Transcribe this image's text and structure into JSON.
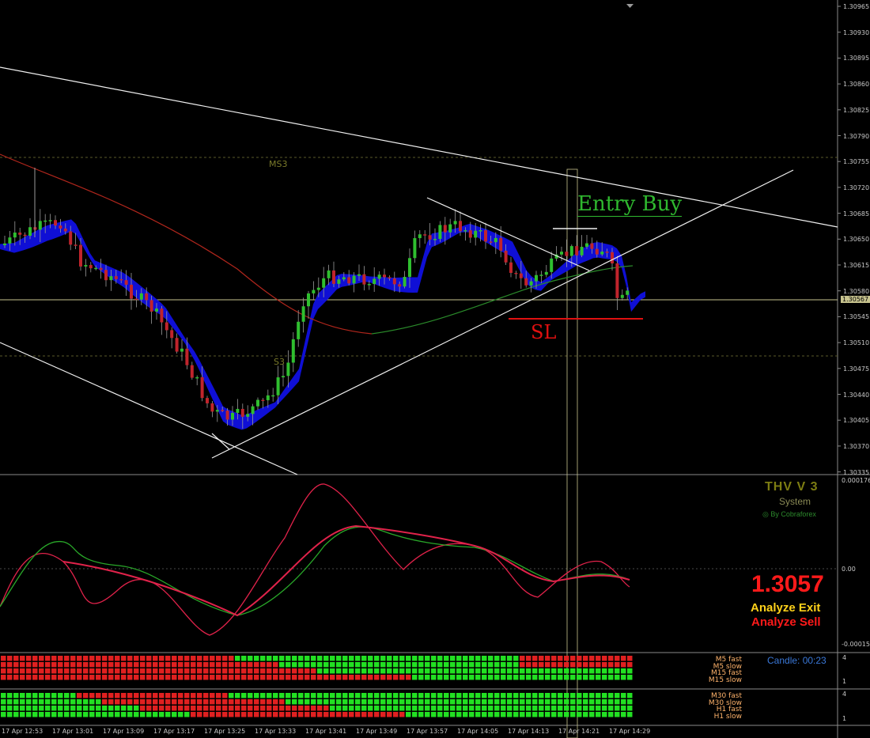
{
  "chart": {
    "symbol_levels": [
      "1.30965",
      "1.30930",
      "1.30895",
      "1.30860",
      "1.30825",
      "1.30790",
      "1.30755",
      "1.30720",
      "1.30685",
      "1.30650",
      "1.30615",
      "1.30580",
      "1.30545",
      "1.30510",
      "1.30475",
      "1.30440",
      "1.30405",
      "1.30370",
      "1.30335"
    ],
    "current_price_tag": "1.30567",
    "level_label_ms3": "MS3",
    "level_label_s3": "S3",
    "annotation_entry": "Entry Buy",
    "annotation_sl": "SL"
  },
  "indicator": {
    "title": "THV V 3",
    "subtitle": "System",
    "byline": "◎ By Cobraforex",
    "scale": [
      "0.000176",
      "0.00",
      "-0.00015"
    ],
    "price_big": "1.3057",
    "analyze_exit": "Analyze Exit",
    "analyze_sell": "Analyze Sell"
  },
  "panel1": {
    "candle_text": "Candle:  00:23",
    "rows": [
      "M5 fast",
      "M5 slow",
      "M15 fast",
      "M15 slow"
    ],
    "scale_top": "4",
    "scale_bottom": "1"
  },
  "panel2": {
    "rows": [
      "M30 fast",
      "M30 slow",
      "H1 fast",
      "H1 slow"
    ],
    "scale_top": "4",
    "scale_bottom": "1"
  },
  "time_axis": [
    "17 Apr 12:53",
    "17 Apr 13:01",
    "17 Apr 13:09",
    "17 Apr 13:17",
    "17 Apr 13:25",
    "17 Apr 13:33",
    "17 Apr 13:41",
    "17 Apr 13:49",
    "17 Apr 13:57",
    "17 Apr 14:05",
    "17 Apr 14:13",
    "17 Apr 14:21",
    "17 Apr 14:29"
  ],
  "colors": {
    "background": "#000000",
    "bull_candle": "#2fbf2f",
    "bear_candle": "#c0242c",
    "cloud": "#1010e0",
    "grid": "#5a5a2a",
    "osc_green": "#29a829",
    "osc_red": "#e0224a",
    "matrix_green": "#22e022",
    "matrix_red": "#e02020"
  }
}
